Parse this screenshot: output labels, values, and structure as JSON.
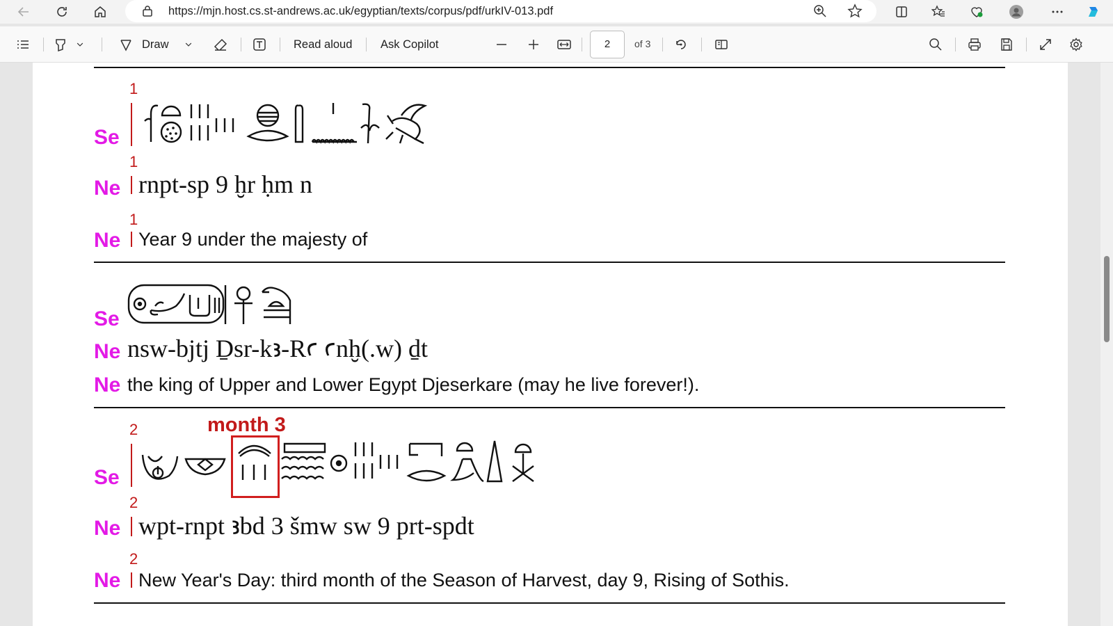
{
  "browser": {
    "url": "https://mjn.host.cs.st-andrews.ac.uk/egyptian/texts/corpus/pdf/urkIV-013.pdf"
  },
  "toolbar": {
    "draw_label": "Draw",
    "read_aloud_label": "Read aloud",
    "ask_copilot_label": "Ask Copilot",
    "current_page": "2",
    "page_of": "of 3"
  },
  "document": {
    "label_se": "Se",
    "label_ne": "Ne",
    "section1": {
      "num_se": "1",
      "num_ne_translit": "1",
      "num_ne_translation": "1",
      "transliteration": "rnpt-sp 9 ḫr ḥm n",
      "translation": "Year 9 under the majesty of"
    },
    "section2": {
      "transliteration": "nsw-bjtj Ḏsr-kꜣ-Rꜥ ꜥnḫ(.w) ḏt",
      "translation": "the king of Upper and Lower Egypt Djeserkare (may he live forever!)."
    },
    "section3": {
      "num_se": "2",
      "num_ne_translit": "2",
      "num_ne_translation": "2",
      "annotation": "month 3",
      "transliteration": "wpt-rnpt ꜣbd 3 šmw sw 9 prt-spdt",
      "translation": "New Year's Day: third month of the Season of Harvest, day 9, Rising of Sothis."
    }
  },
  "icons": [
    "back-icon",
    "refresh-icon",
    "home-icon",
    "lock-icon",
    "zoom-icon",
    "favorite-star-icon",
    "split-screen-icon",
    "favorites-icon",
    "browser-essentials-icon",
    "profile-avatar",
    "more-icon",
    "copilot-icon",
    "contents-icon",
    "highlight-icon",
    "draw-icon",
    "erase-icon",
    "text-icon",
    "zoom-out-icon",
    "zoom-in-icon",
    "fit-page-icon",
    "rotate-icon",
    "page-view-icon",
    "search-icon",
    "print-icon",
    "save-icon",
    "fullscreen-icon",
    "settings-icon"
  ]
}
